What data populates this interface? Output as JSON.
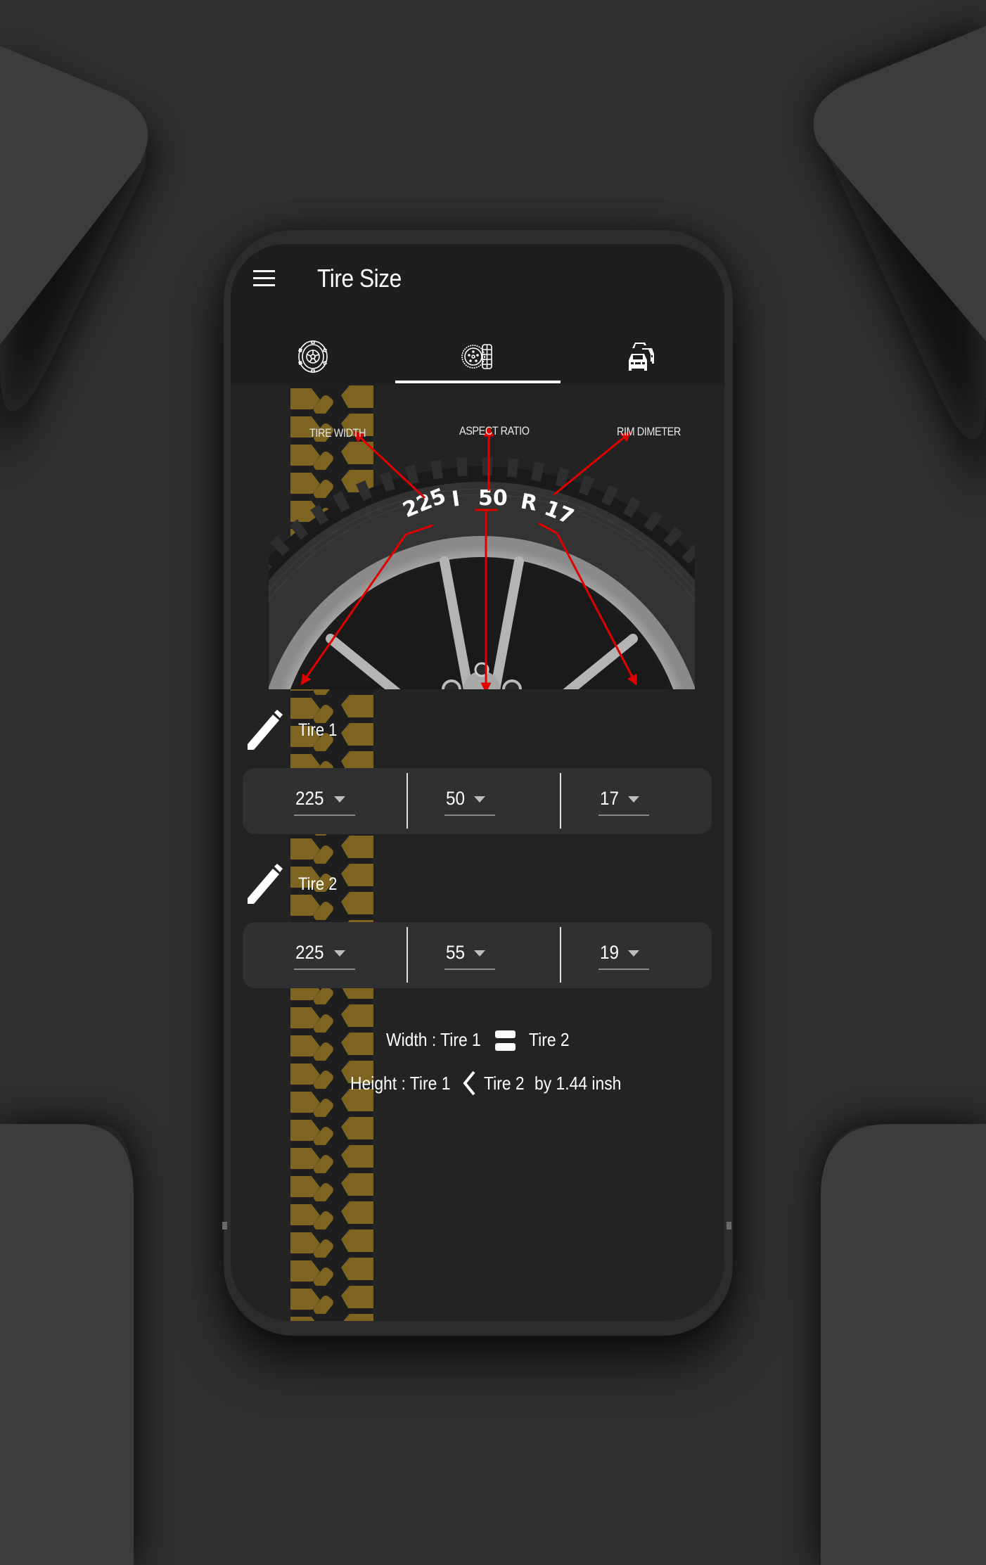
{
  "app": {
    "title": "Tire Size",
    "menu_icon": "hamburger-menu-icon"
  },
  "tabs": [
    {
      "name": "wheel-rim",
      "icon": "wheel-rim-icon",
      "selected": false
    },
    {
      "name": "tire-size",
      "icon": "tire-side-icon",
      "selected": true
    },
    {
      "name": "vehicles",
      "icon": "cars-traffic-icon",
      "selected": false
    }
  ],
  "diagram": {
    "labels": {
      "tire_width": "TIRE WIDTH",
      "aspect_ratio": "ASPECT RATIO",
      "rim_diameter": "RIM DIMETER"
    },
    "sidewall": {
      "width": "225",
      "separator": "I",
      "ratio": "50",
      "construction": "R",
      "rim": "17"
    },
    "arrow_color": "#e00000"
  },
  "tire1": {
    "label": "Tire 1",
    "edit_icon": "pencil-icon",
    "width": "225",
    "aspect_ratio": "50",
    "rim": "17"
  },
  "tire2": {
    "label": "Tire 2",
    "edit_icon": "pencil-icon",
    "width": "225",
    "aspect_ratio": "55",
    "rim": "19"
  },
  "comparison": {
    "width": {
      "prefix": "Width : Tire 1",
      "operator_icon": "equals-icon",
      "suffix": "Tire 2"
    },
    "height": {
      "prefix": "Height : Tire 1",
      "operator_icon": "less-than-icon",
      "suffix": "Tire 2",
      "difference": "by 1.44 insh"
    }
  },
  "colors": {
    "tread": "#7d6420",
    "appbar": "#1e1e1e",
    "content": "#232323",
    "card": "#303032"
  }
}
